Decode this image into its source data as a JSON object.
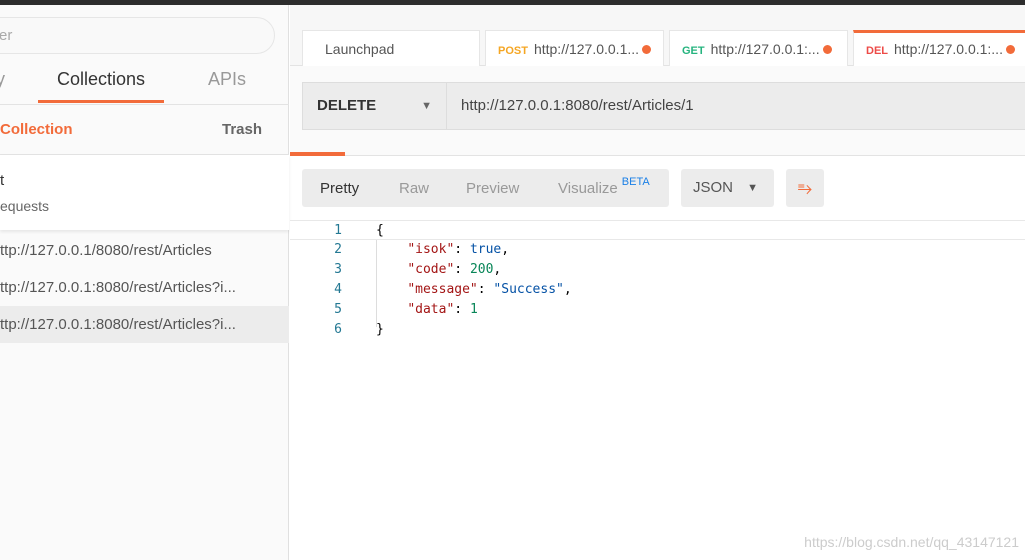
{
  "sidebar": {
    "search_placeholder": "er",
    "tabs": [
      "y",
      "Collections",
      "APIs"
    ],
    "new_collection": "Collection",
    "trash": "Trash",
    "collection": {
      "name": "t",
      "sub": "equests"
    },
    "history": [
      "ttp://127.0.0.1/8080/rest/Articles",
      "ttp://127.0.0.1:8080/rest/Articles?i...",
      "ttp://127.0.0.1:8080/rest/Articles?i..."
    ]
  },
  "tabs": [
    {
      "label": "Launchpad"
    },
    {
      "method": "POST",
      "label": "http://127.0.0.1...",
      "color": "#f5a623"
    },
    {
      "method": "GET",
      "label": "http://127.0.0.1:...",
      "color": "#26b47f"
    },
    {
      "method": "DEL",
      "label": "http://127.0.0.1:...",
      "color": "#ed4b48"
    }
  ],
  "request": {
    "method": "DELETE",
    "url": "http://127.0.0.1:8080/rest/Articles/1"
  },
  "response": {
    "views": [
      "Pretty",
      "Raw",
      "Preview",
      "Visualize"
    ],
    "beta": "BETA",
    "format": "JSON",
    "lines": [
      "1",
      "2",
      "3",
      "4",
      "5",
      "6"
    ],
    "body": {
      "open": "{",
      "k1": "\"isok\"",
      "v1": "true",
      "k2": "\"code\"",
      "v2": "200",
      "k3": "\"message\"",
      "v3": "\"Success\"",
      "k4": "\"data\"",
      "v4": "1",
      "close": "}"
    }
  },
  "watermark": "https://blog.csdn.net/qq_43147121",
  "accent": "#f26b3a"
}
